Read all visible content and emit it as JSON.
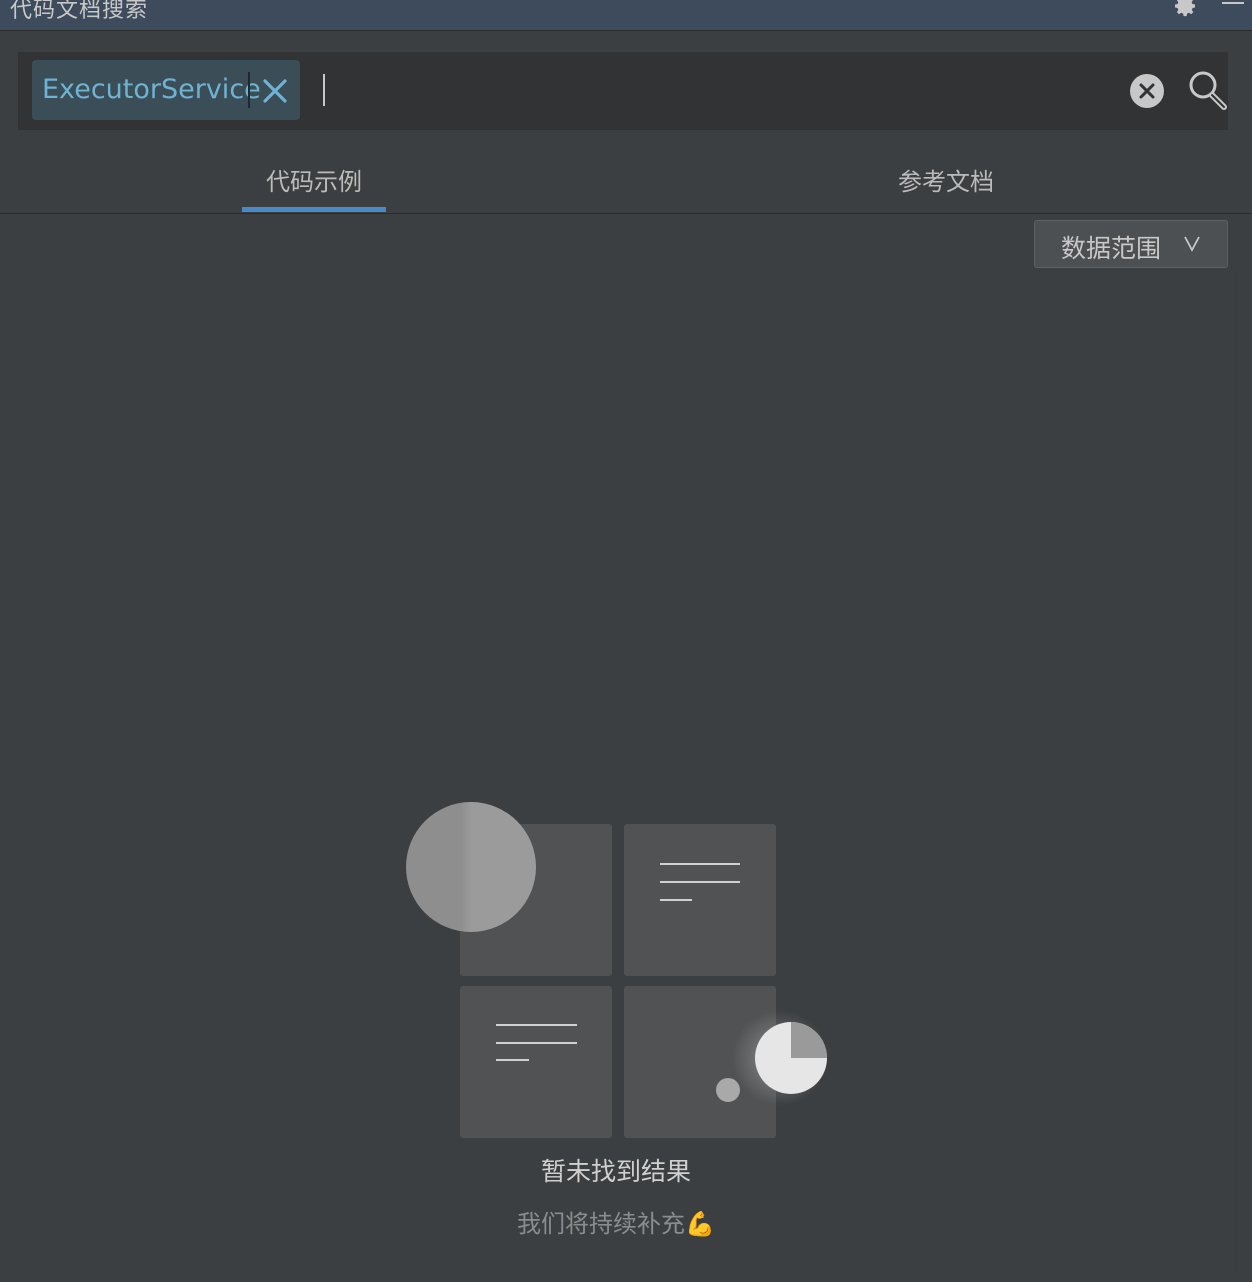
{
  "window": {
    "title": "代码文档搜索",
    "gear_icon": "gear-icon",
    "minimize_icon": "minimize-icon"
  },
  "search": {
    "chip_label": "ExecutorService",
    "query": "",
    "clear_icon": "clear-circle-icon",
    "search_icon": "magnifier-icon"
  },
  "tabs": [
    {
      "label": "代码示例",
      "active": true
    },
    {
      "label": "参考文档",
      "active": false
    }
  ],
  "filter": {
    "label": "数据范围",
    "chevron": "v"
  },
  "empty_state": {
    "title": "暂未找到结果",
    "subtitle": "我们将持续补充💪"
  },
  "colors": {
    "accent": "#4a88c7",
    "chip_text": "#6fb3d2",
    "background": "#3c3f41"
  }
}
